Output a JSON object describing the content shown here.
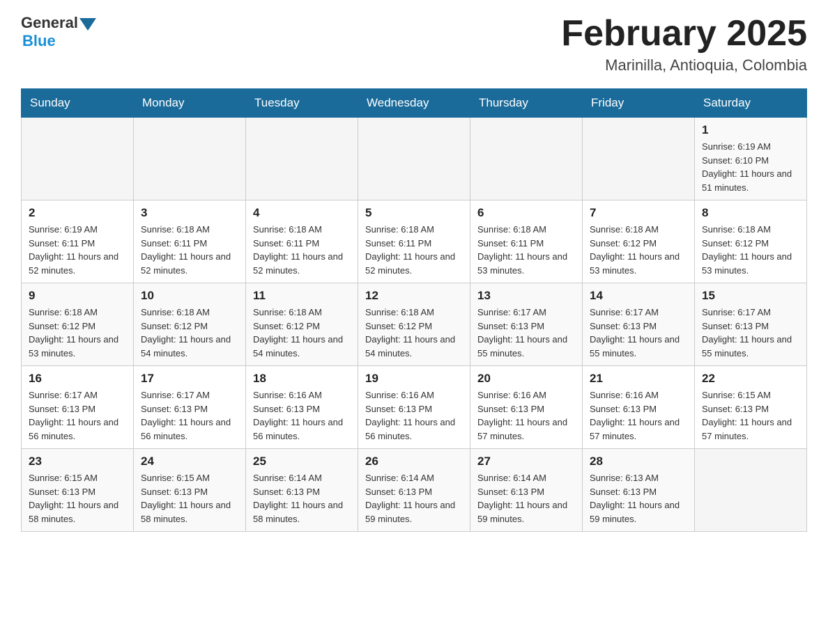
{
  "header": {
    "logo_general": "General",
    "logo_blue": "Blue",
    "title": "February 2025",
    "location": "Marinilla, Antioquia, Colombia"
  },
  "days_of_week": [
    "Sunday",
    "Monday",
    "Tuesday",
    "Wednesday",
    "Thursday",
    "Friday",
    "Saturday"
  ],
  "weeks": [
    [
      {
        "day": "",
        "info": ""
      },
      {
        "day": "",
        "info": ""
      },
      {
        "day": "",
        "info": ""
      },
      {
        "day": "",
        "info": ""
      },
      {
        "day": "",
        "info": ""
      },
      {
        "day": "",
        "info": ""
      },
      {
        "day": "1",
        "info": "Sunrise: 6:19 AM\nSunset: 6:10 PM\nDaylight: 11 hours and 51 minutes."
      }
    ],
    [
      {
        "day": "2",
        "info": "Sunrise: 6:19 AM\nSunset: 6:11 PM\nDaylight: 11 hours and 52 minutes."
      },
      {
        "day": "3",
        "info": "Sunrise: 6:18 AM\nSunset: 6:11 PM\nDaylight: 11 hours and 52 minutes."
      },
      {
        "day": "4",
        "info": "Sunrise: 6:18 AM\nSunset: 6:11 PM\nDaylight: 11 hours and 52 minutes."
      },
      {
        "day": "5",
        "info": "Sunrise: 6:18 AM\nSunset: 6:11 PM\nDaylight: 11 hours and 52 minutes."
      },
      {
        "day": "6",
        "info": "Sunrise: 6:18 AM\nSunset: 6:11 PM\nDaylight: 11 hours and 53 minutes."
      },
      {
        "day": "7",
        "info": "Sunrise: 6:18 AM\nSunset: 6:12 PM\nDaylight: 11 hours and 53 minutes."
      },
      {
        "day": "8",
        "info": "Sunrise: 6:18 AM\nSunset: 6:12 PM\nDaylight: 11 hours and 53 minutes."
      }
    ],
    [
      {
        "day": "9",
        "info": "Sunrise: 6:18 AM\nSunset: 6:12 PM\nDaylight: 11 hours and 53 minutes."
      },
      {
        "day": "10",
        "info": "Sunrise: 6:18 AM\nSunset: 6:12 PM\nDaylight: 11 hours and 54 minutes."
      },
      {
        "day": "11",
        "info": "Sunrise: 6:18 AM\nSunset: 6:12 PM\nDaylight: 11 hours and 54 minutes."
      },
      {
        "day": "12",
        "info": "Sunrise: 6:18 AM\nSunset: 6:12 PM\nDaylight: 11 hours and 54 minutes."
      },
      {
        "day": "13",
        "info": "Sunrise: 6:17 AM\nSunset: 6:13 PM\nDaylight: 11 hours and 55 minutes."
      },
      {
        "day": "14",
        "info": "Sunrise: 6:17 AM\nSunset: 6:13 PM\nDaylight: 11 hours and 55 minutes."
      },
      {
        "day": "15",
        "info": "Sunrise: 6:17 AM\nSunset: 6:13 PM\nDaylight: 11 hours and 55 minutes."
      }
    ],
    [
      {
        "day": "16",
        "info": "Sunrise: 6:17 AM\nSunset: 6:13 PM\nDaylight: 11 hours and 56 minutes."
      },
      {
        "day": "17",
        "info": "Sunrise: 6:17 AM\nSunset: 6:13 PM\nDaylight: 11 hours and 56 minutes."
      },
      {
        "day": "18",
        "info": "Sunrise: 6:16 AM\nSunset: 6:13 PM\nDaylight: 11 hours and 56 minutes."
      },
      {
        "day": "19",
        "info": "Sunrise: 6:16 AM\nSunset: 6:13 PM\nDaylight: 11 hours and 56 minutes."
      },
      {
        "day": "20",
        "info": "Sunrise: 6:16 AM\nSunset: 6:13 PM\nDaylight: 11 hours and 57 minutes."
      },
      {
        "day": "21",
        "info": "Sunrise: 6:16 AM\nSunset: 6:13 PM\nDaylight: 11 hours and 57 minutes."
      },
      {
        "day": "22",
        "info": "Sunrise: 6:15 AM\nSunset: 6:13 PM\nDaylight: 11 hours and 57 minutes."
      }
    ],
    [
      {
        "day": "23",
        "info": "Sunrise: 6:15 AM\nSunset: 6:13 PM\nDaylight: 11 hours and 58 minutes."
      },
      {
        "day": "24",
        "info": "Sunrise: 6:15 AM\nSunset: 6:13 PM\nDaylight: 11 hours and 58 minutes."
      },
      {
        "day": "25",
        "info": "Sunrise: 6:14 AM\nSunset: 6:13 PM\nDaylight: 11 hours and 58 minutes."
      },
      {
        "day": "26",
        "info": "Sunrise: 6:14 AM\nSunset: 6:13 PM\nDaylight: 11 hours and 59 minutes."
      },
      {
        "day": "27",
        "info": "Sunrise: 6:14 AM\nSunset: 6:13 PM\nDaylight: 11 hours and 59 minutes."
      },
      {
        "day": "28",
        "info": "Sunrise: 6:13 AM\nSunset: 6:13 PM\nDaylight: 11 hours and 59 minutes."
      },
      {
        "day": "",
        "info": ""
      }
    ]
  ]
}
